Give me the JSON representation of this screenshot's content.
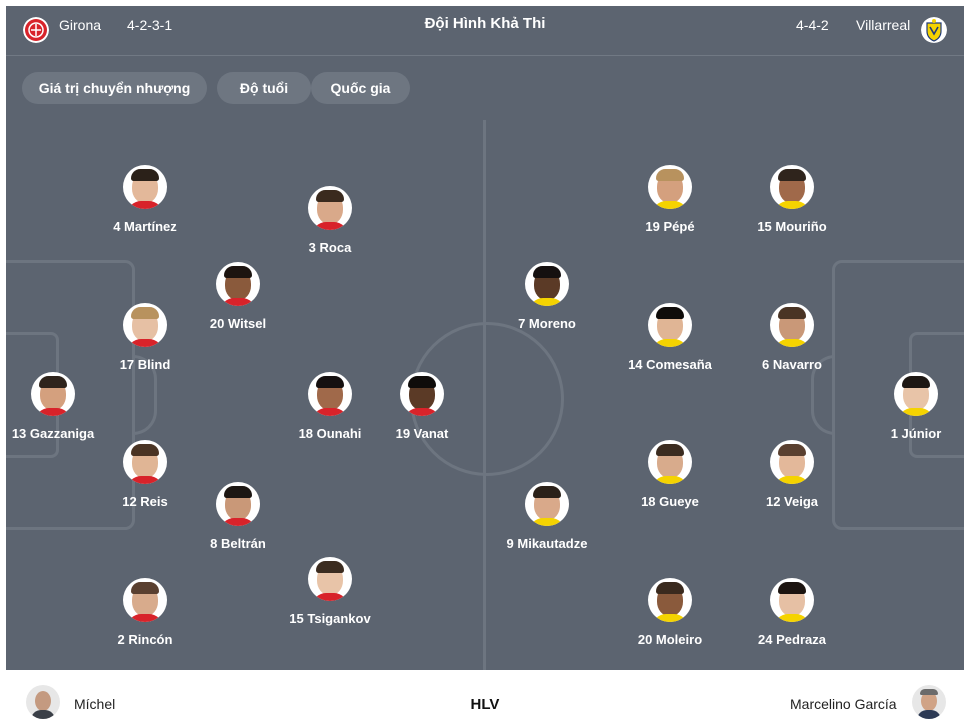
{
  "header": {
    "title": "Đội Hình Khả Thi",
    "home": {
      "name": "Girona",
      "formation": "4-2-3-1",
      "logo_icon": "girona-crest-icon",
      "color": "#d8232a"
    },
    "away": {
      "name": "Villarreal",
      "formation": "4-4-2",
      "logo_icon": "villarreal-crest-icon",
      "color": "#f5d300"
    }
  },
  "filters": [
    "Giá trị chuyển nhượng",
    "Độ tuổi",
    "Quốc gia"
  ],
  "home_players": [
    {
      "label": "4 Martínez"
    },
    {
      "label": "3 Roca"
    },
    {
      "label": "20 Witsel"
    },
    {
      "label": "17 Blind"
    },
    {
      "label": "13 Gazzaniga"
    },
    {
      "label": "18 Ounahi"
    },
    {
      "label": "19 Vanat"
    },
    {
      "label": "12 Reis"
    },
    {
      "label": "8 Beltrán"
    },
    {
      "label": "15 Tsigankov"
    },
    {
      "label": "2 Rincón"
    }
  ],
  "away_players": [
    {
      "label": "19 Pépé"
    },
    {
      "label": "15 Mouriño"
    },
    {
      "label": "7 Moreno"
    },
    {
      "label": "14 Comesaña"
    },
    {
      "label": "6 Navarro"
    },
    {
      "label": "1 Júnior"
    },
    {
      "label": "18 Gueye"
    },
    {
      "label": "12 Veiga"
    },
    {
      "label": "9 Mikautadze"
    },
    {
      "label": "20 Moleiro"
    },
    {
      "label": "24 Pedraza"
    }
  ],
  "footer": {
    "label": "HLV",
    "home_coach": "Míchel",
    "away_coach": "Marcelino García"
  },
  "colors": {
    "pitch": "#5c6470",
    "lines": "#6d7580",
    "chip": "#6e7681"
  }
}
